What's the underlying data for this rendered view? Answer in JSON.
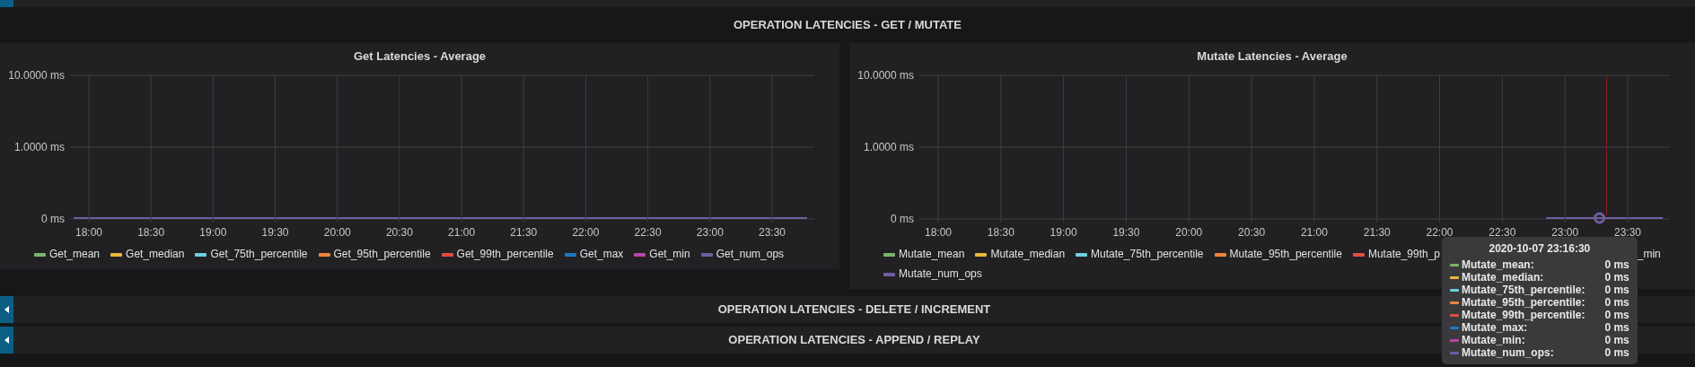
{
  "rows": [
    {
      "title": "OPERATION LATENCIES - GET / MUTATE",
      "collapsed": false,
      "panels": [
        {
          "title": "Get Latencies - Average",
          "y_axis_labels": [
            "10.0000 ms",
            "1.0000 ms",
            "0 ms"
          ],
          "x_axis_labels": [
            {
              "label": "18:00",
              "has_data": true
            },
            {
              "label": "18:30",
              "has_data": true
            },
            {
              "label": "19:00",
              "has_data": true
            },
            {
              "label": "19:30",
              "has_data": true
            },
            {
              "label": "20:00",
              "has_data": true
            },
            {
              "label": "20:30",
              "has_data": true
            },
            {
              "label": "21:00",
              "has_data": true
            },
            {
              "label": "21:30",
              "has_data": true
            },
            {
              "label": "22:00",
              "has_data": true
            },
            {
              "label": "22:30",
              "has_data": true
            },
            {
              "label": "23:00",
              "has_data": true
            },
            {
              "label": "23:30",
              "has_data": true
            }
          ],
          "legend": [
            {
              "label": "Get_mean",
              "color": "#7eb26d"
            },
            {
              "label": "Get_median",
              "color": "#eab839"
            },
            {
              "label": "Get_75th_percentile",
              "color": "#6ed0e0"
            },
            {
              "label": "Get_95th_percentile",
              "color": "#ef843c"
            },
            {
              "label": "Get_99th_percentile",
              "color": "#e24d42"
            },
            {
              "label": "Get_max",
              "color": "#1f78c1"
            },
            {
              "label": "Get_min",
              "color": "#ba43a9"
            },
            {
              "label": "Get_num_ops",
              "color": "#705da0"
            }
          ]
        },
        {
          "title": "Mutate Latencies - Average",
          "y_axis_labels": [
            "10.0000 ms",
            "1.0000 ms",
            "0 ms"
          ],
          "x_axis_labels": [
            {
              "label": "18:00",
              "has_data": false
            },
            {
              "label": "18:30",
              "has_data": false
            },
            {
              "label": "19:00",
              "has_data": false
            },
            {
              "label": "19:30",
              "has_data": false
            },
            {
              "label": "20:00",
              "has_data": false
            },
            {
              "label": "20:30",
              "has_data": false
            },
            {
              "label": "21:00",
              "has_data": false
            },
            {
              "label": "21:30",
              "has_data": false
            },
            {
              "label": "22:00",
              "has_data": false
            },
            {
              "label": "22:30",
              "has_data": false
            },
            {
              "label": "23:00",
              "has_data": true
            },
            {
              "label": "23:30",
              "has_data": true
            }
          ],
          "legend": [
            {
              "label": "Mutate_mean",
              "color": "#7eb26d"
            },
            {
              "label": "Mutate_median",
              "color": "#eab839"
            },
            {
              "label": "Mutate_75th_percentile",
              "color": "#6ed0e0"
            },
            {
              "label": "Mutate_95th_percentile",
              "color": "#ef843c"
            },
            {
              "label": "Mutate_99th_p",
              "color": "#e24d42",
              "covered": true
            },
            {
              "label": "_min"
            },
            {
              "label": "Mutate_num_ops",
              "color": "#705da0"
            }
          ],
          "tooltip": {
            "title": "2020-10-07 23:16:30",
            "rows": [
              {
                "label": "Mutate_mean:",
                "value": "0 ms",
                "color": "#7eb26d"
              },
              {
                "label": "Mutate_median:",
                "value": "0 ms",
                "color": "#eab839"
              },
              {
                "label": "Mutate_75th_percentile:",
                "value": "0 ms",
                "color": "#6ed0e0"
              },
              {
                "label": "Mutate_95th_percentile:",
                "value": "0 ms",
                "color": "#ef843c"
              },
              {
                "label": "Mutate_99th_percentile:",
                "value": "0 ms",
                "color": "#e24d42"
              },
              {
                "label": "Mutate_max:",
                "value": "0 ms",
                "color": "#1f78c1"
              },
              {
                "label": "Mutate_min:",
                "value": "0 ms",
                "color": "#ba43a9"
              },
              {
                "label": "Mutate_num_ops:",
                "value": "0 ms",
                "color": "#705da0"
              }
            ]
          }
        }
      ]
    },
    {
      "title": "OPERATION LATENCIES - DELETE / INCREMENT",
      "collapsed": true
    },
    {
      "title": "OPERATION LATENCIES - APPEND / REPLAY",
      "collapsed": true
    }
  ]
}
